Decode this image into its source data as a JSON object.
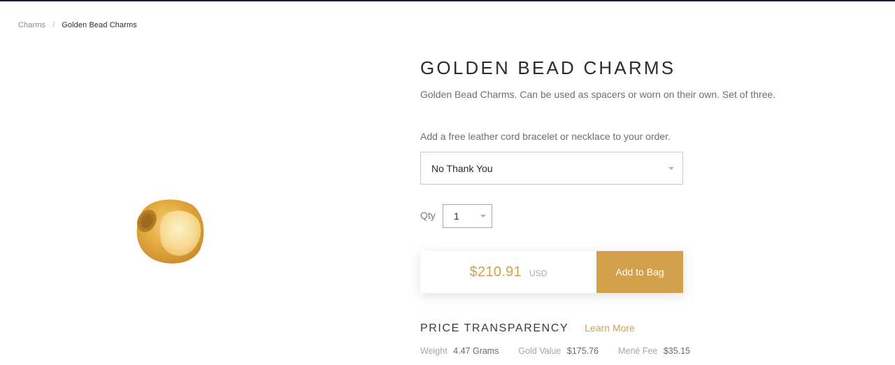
{
  "breadcrumb": {
    "parent": "Charms",
    "separator": "/",
    "current": "Golden Bead Charms"
  },
  "product": {
    "title": "GOLDEN BEAD CHARMS",
    "description": "Golden Bead Charms. Can be used as spacers or worn on their own. Set of three.",
    "image_icon": "gold-bead-image"
  },
  "addon": {
    "label": "Add a free leather cord bracelet or necklace to your order.",
    "selected": "No Thank You"
  },
  "quantity": {
    "label": "Qty",
    "selected": "1"
  },
  "purchase": {
    "price": "$210.91",
    "currency": "USD",
    "button_label": "Add to Bag"
  },
  "transparency": {
    "title": "PRICE TRANSPARENCY",
    "learn_more": "Learn More",
    "stats": [
      {
        "label": "Weight",
        "value": "4.47 Grams"
      },
      {
        "label": "Gold Value",
        "value": "$175.76"
      },
      {
        "label": "Menē Fee",
        "value": "$35.15"
      }
    ]
  },
  "colors": {
    "accent_gold": "#d3a04c",
    "top_bar": "#1d1f3a"
  }
}
